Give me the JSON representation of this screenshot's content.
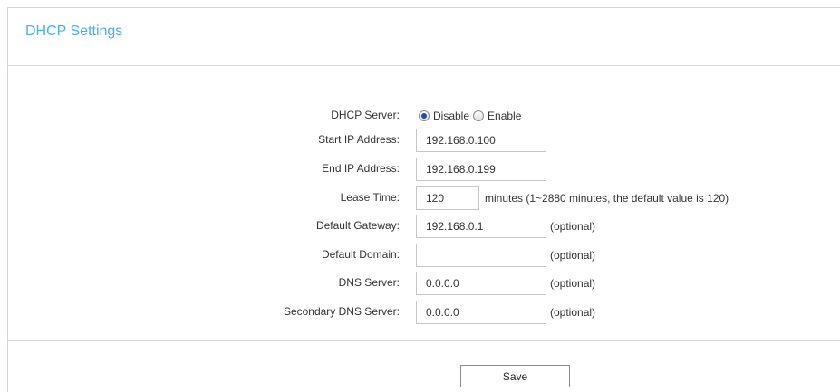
{
  "panel": {
    "title": "DHCP Settings"
  },
  "form": {
    "dhcp_server": {
      "label": "DHCP Server:",
      "options": [
        "Disable",
        "Enable"
      ],
      "selected": "Disable"
    },
    "start_ip": {
      "label": "Start IP Address:",
      "value": "192.168.0.100"
    },
    "end_ip": {
      "label": "End IP Address:",
      "value": "192.168.0.199"
    },
    "lease_time": {
      "label": "Lease Time:",
      "value": "120",
      "hint": "minutes (1~2880 minutes, the default value is 120)"
    },
    "default_gateway": {
      "label": "Default Gateway:",
      "value": "192.168.0.1",
      "hint": "(optional)"
    },
    "default_domain": {
      "label": "Default Domain:",
      "value": "",
      "hint": "(optional)"
    },
    "dns_server": {
      "label": "DNS Server:",
      "value": "0.0.0.0",
      "hint": "(optional)"
    },
    "secondary_dns_server": {
      "label": "Secondary DNS Server:",
      "value": "0.0.0.0",
      "hint": "(optional)"
    }
  },
  "actions": {
    "save_label": "Save"
  },
  "colors": {
    "title": "#4ab0e6",
    "divider": "#d9d9d9",
    "radio_selected": "#1f4fa0"
  }
}
